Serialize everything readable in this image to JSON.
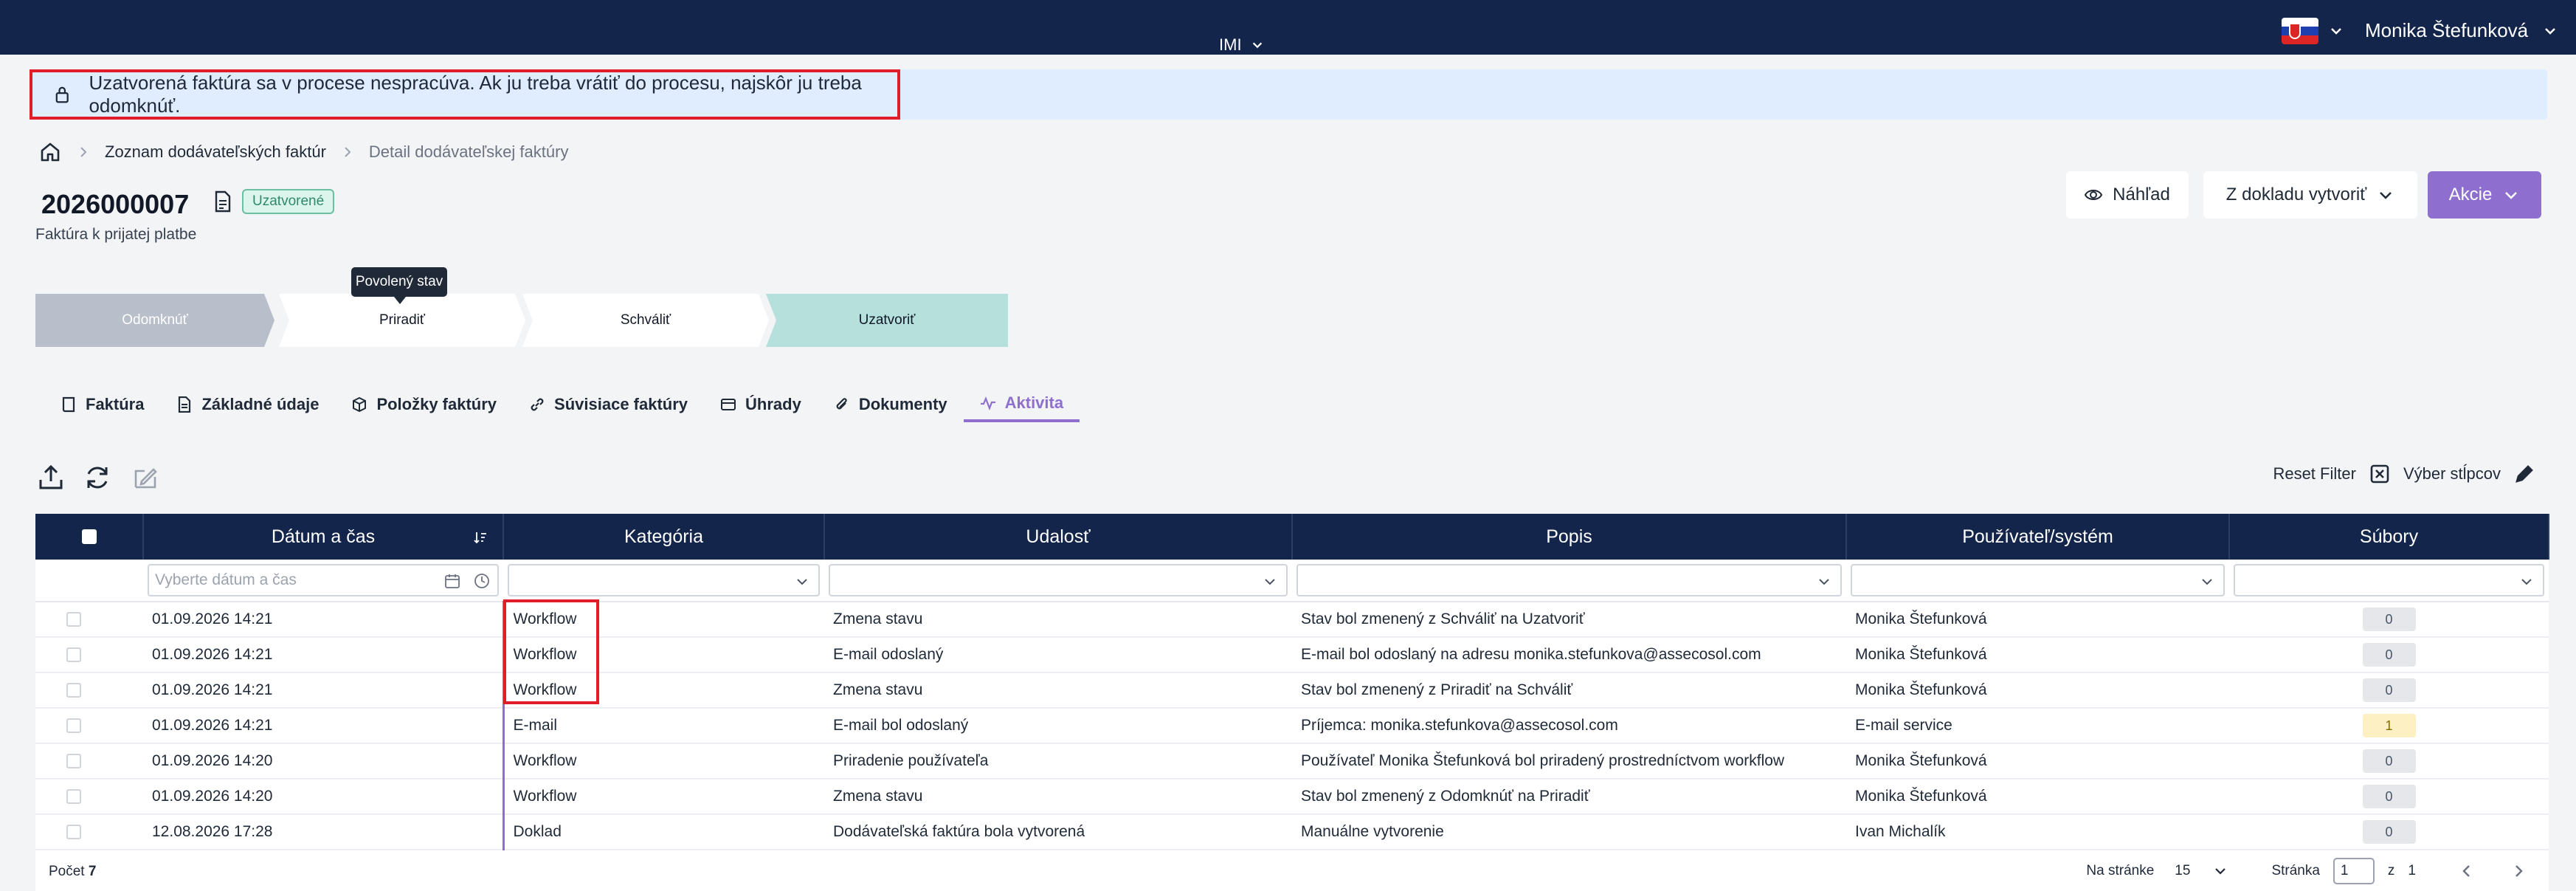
{
  "topbar": {
    "org_label": "IMI",
    "user_name": "Monika Štefunková",
    "language_flag": "slovak-flag-icon"
  },
  "alert": {
    "message": "Uzatvorená faktúra sa v procese nespracúva. Ak ju treba vrátiť do procesu, najskôr ju treba odomknúť."
  },
  "breadcrumb": {
    "items": [
      "Zoznam dodávateľských faktúr",
      "Detail dodávateľskej faktúry"
    ]
  },
  "header": {
    "title": "2026000007",
    "status": "Uzatvorené",
    "subtitle": "Faktúra k prijatej platbe",
    "preview_label": "Náhľad",
    "create_label": "Z dokladu vytvoriť",
    "actions_label": "Akcie"
  },
  "workflow": {
    "tooltip": "Povolený stav",
    "steps": [
      "Odomknúť",
      "Priradiť",
      "Schváliť",
      "Uzatvoriť"
    ]
  },
  "tabs": [
    {
      "label": "Faktúra",
      "icon": "book-icon"
    },
    {
      "label": "Základné údaje",
      "icon": "document-icon"
    },
    {
      "label": "Položky faktúry",
      "icon": "box-icon"
    },
    {
      "label": "Súvisiace faktúry",
      "icon": "link-icon"
    },
    {
      "label": "Úhrady",
      "icon": "card-icon"
    },
    {
      "label": "Dokumenty",
      "icon": "paperclip-icon"
    },
    {
      "label": "Aktivita",
      "icon": "activity-icon"
    }
  ],
  "toolbar": {
    "reset_filter": "Reset Filter",
    "column_select": "Výber stĺpcov"
  },
  "table": {
    "columns": [
      "Dátum a čas",
      "Kategória",
      "Udalosť",
      "Popis",
      "Používateľ/systém",
      "Súbory"
    ],
    "date_placeholder": "Vyberte dátum a čas",
    "rows": [
      {
        "date": "01.09.2026 14:21",
        "category": "Workflow",
        "event": "Zmena stavu",
        "description": "Stav bol zmenený z Schváliť na Uzatvoriť",
        "user": "Monika Štefunková",
        "files": "0"
      },
      {
        "date": "01.09.2026 14:21",
        "category": "Workflow",
        "event": "E-mail odoslaný",
        "description": "E-mail bol odoslaný na adresu monika.stefunkova@assecosol.com",
        "user": "Monika Štefunková",
        "files": "0"
      },
      {
        "date": "01.09.2026 14:21",
        "category": "Workflow",
        "event": "Zmena stavu",
        "description": "Stav bol zmenený z Priradiť na Schváliť",
        "user": "Monika Štefunková",
        "files": "0"
      },
      {
        "date": "01.09.2026 14:21",
        "category": "E-mail",
        "event": "E-mail bol odoslaný",
        "description": "Príjemca: monika.stefunkova@assecosol.com",
        "user": "E-mail service",
        "files": "1"
      },
      {
        "date": "01.09.2026 14:20",
        "category": "Workflow",
        "event": "Priradenie používateľa",
        "description": "Používateľ Monika Štefunková bol priradený prostredníctvom workflow",
        "user": "Monika Štefunková",
        "files": "0"
      },
      {
        "date": "01.09.2026 14:20",
        "category": "Workflow",
        "event": "Zmena stavu",
        "description": "Stav bol zmenený z Odomknúť na Priradiť",
        "user": "Monika Štefunková",
        "files": "0"
      },
      {
        "date": "12.08.2026 17:28",
        "category": "Doklad",
        "event": "Dodávateľská faktúra bola vytvorená",
        "description": "Manuálne vytvorenie",
        "user": "Ivan Michalík",
        "files": "0"
      }
    ]
  },
  "footer": {
    "count_label": "Počet",
    "count": "7",
    "per_page_label": "Na stránke",
    "per_page": "15",
    "page_label": "Stránka",
    "page": "1",
    "of_label": "z",
    "total_pages": "1"
  }
}
